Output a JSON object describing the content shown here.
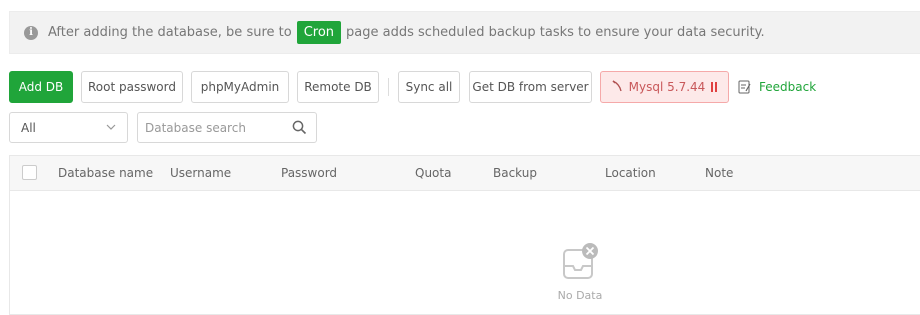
{
  "notice": {
    "text_before": "After adding the database, be sure to",
    "cron_label": "Cron",
    "text_after": "page adds scheduled backup tasks to ensure your data security."
  },
  "toolbar": {
    "add_db": "Add DB",
    "root_password": "Root password",
    "phpmyadmin": "phpMyAdmin",
    "remote_db": "Remote DB",
    "sync_all": "Sync all",
    "get_db_from_server": "Get DB from server",
    "mysql_version": "Mysql 5.7.44",
    "feedback": "Feedback"
  },
  "filter": {
    "selected": "All",
    "search_placeholder": "Database search"
  },
  "table": {
    "columns": [
      "Database name",
      "Username",
      "Password",
      "Quota",
      "Backup",
      "Location",
      "Note"
    ],
    "empty_text": "No Data"
  },
  "colors": {
    "accent": "#20a53a",
    "mysql_stopped_bg": "#fde9e9",
    "mysql_stopped_text": "#c8585a"
  },
  "icons": [
    "info-icon",
    "leaf-icon",
    "pause-icon",
    "feedback-icon",
    "chevron-down-icon",
    "search-icon",
    "empty-box-icon"
  ]
}
